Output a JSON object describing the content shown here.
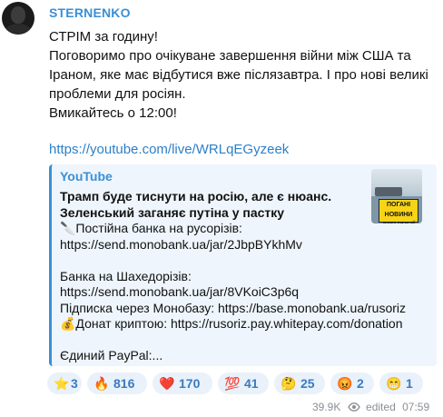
{
  "channel": {
    "name": "STERNENKO"
  },
  "message": {
    "lines": [
      "СТРІМ за годину!",
      "Поговоримо про очікуване завершення війни між США та",
      "Іраном, яке має відбутися вже післязавтра. І про нові великі",
      "проблеми для росіян.",
      "Вмикайтесь о 12:00!"
    ],
    "link": "https://youtube.com/live/WRLqEGyzeek"
  },
  "preview": {
    "site": "YouTube",
    "title_line1": "Трамп буде тиснути на росію, але є нюанс.",
    "title_line2": "Зеленський заганяє путіна у пастку",
    "body": [
      "🔪Постійна банка на русорізів:",
      "https://send.monobank.ua/jar/2JbpBYkhMv",
      "",
      "Банка на Шахедорізів:",
      "https://send.monobank.ua/jar/8VKoiC3p6q",
      "Підписка через Монобазу: https://base.monobank.ua/rusoriz",
      "💰Донат криптою: https://rusoriz.pay.whitepay.com/donation",
      "",
      "Єдиний PayPal:..."
    ],
    "thumb_badge": "ПОГАНІ НОВИНИ ДЛЯ РОСІЇ"
  },
  "reactions": [
    {
      "emoji": "⭐",
      "count": "3"
    },
    {
      "emoji": "🔥",
      "count": "816"
    },
    {
      "emoji": "❤️",
      "count": "170"
    },
    {
      "emoji": "💯",
      "count": "41"
    },
    {
      "emoji": "🤔",
      "count": "25"
    },
    {
      "emoji": "😡",
      "count": "2"
    },
    {
      "emoji": "😁",
      "count": "1"
    }
  ],
  "meta": {
    "views": "39.9K",
    "edited": "edited",
    "time": "07:59"
  },
  "colors": {
    "accent": "#3a8fd6",
    "link": "#2d7fc8",
    "preview_bg": "#eef5fc",
    "reaction_bg": "#e9f1fa"
  }
}
